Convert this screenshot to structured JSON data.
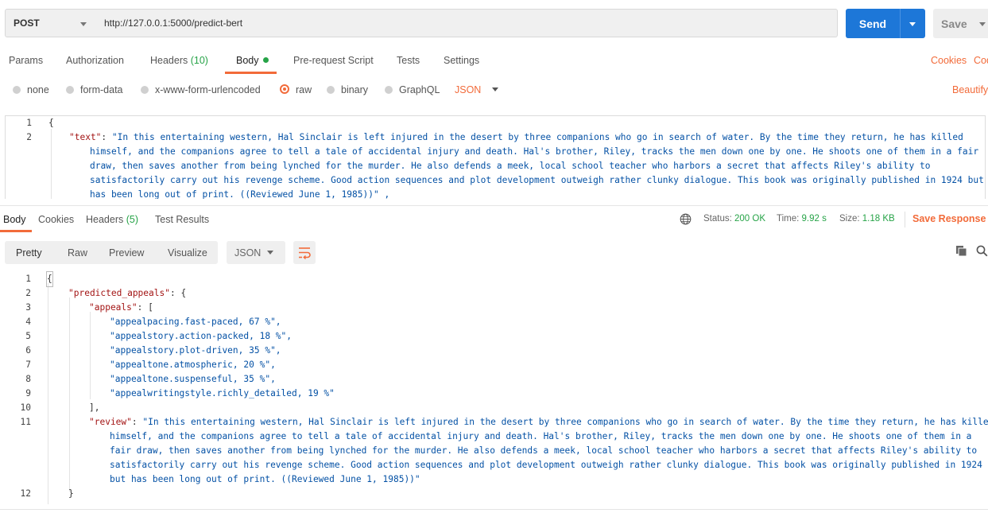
{
  "request": {
    "method": "POST",
    "url": "http://127.0.0.1:5000/predict-bert",
    "send_label": "Send",
    "save_label": "Save"
  },
  "request_tabs": {
    "params": "Params",
    "authorization": "Authorization",
    "headers": "Headers",
    "headers_count": "(10)",
    "body": "Body",
    "prerequest": "Pre-request Script",
    "tests": "Tests",
    "settings": "Settings",
    "cookies": "Cookies",
    "code": "Cod"
  },
  "body_types": {
    "none": "none",
    "form_data": "form-data",
    "urlencoded": "x-www-form-urlencoded",
    "raw": "raw",
    "binary": "binary",
    "graphql": "GraphQL",
    "format": "JSON",
    "beautify": "Beautify"
  },
  "request_body": {
    "line_numbers": [
      "1",
      "2"
    ],
    "open_brace": "{",
    "key": "\"text\"",
    "colon": ": ",
    "value_lines": [
      "\"In this entertaining western, Hal Sinclair is left injured in the desert by three companions who go in search of water. By the time they return, he has killed",
      "himself, and the companions agree to tell a tale of accidental injury and death. Hal's brother, Riley, tracks the men down one by one. He shoots one of them in a fair",
      "draw, then saves another from being lynched for the murder. He also defends a meek, local school teacher who harbors a secret that affects Riley's ability to",
      "satisfactorily carry out his revenge scheme. Good action sequences and plot development outweigh rather clunky dialogue. This book was originally published in 1924 but",
      "has been long out of print. ((Reviewed June 1, 1985))\" ,"
    ]
  },
  "response_tabs": {
    "body": "Body",
    "cookies": "Cookies",
    "headers": "Headers",
    "headers_count": "(5)",
    "test_results": "Test Results"
  },
  "response_status": {
    "status_label": "Status:",
    "status_value": "200 OK",
    "time_label": "Time:",
    "time_value": "9.92 s",
    "size_label": "Size:",
    "size_value": "1.18 KB",
    "save_response": "Save Response"
  },
  "view_modes": {
    "pretty": "Pretty",
    "raw": "Raw",
    "preview": "Preview",
    "visualize": "Visualize",
    "format": "JSON"
  },
  "response_body": {
    "line_numbers": [
      "1",
      "2",
      "3",
      "4",
      "5",
      "6",
      "7",
      "8",
      "9",
      "10",
      "11",
      "12"
    ],
    "open_brace": "{",
    "predicted_key": "\"predicted_appeals\"",
    "predicted_open": ": {",
    "appeals_key": "\"appeals\"",
    "appeals_open": ": [",
    "appeals": [
      "\"appealpacing.fast-paced, 67 %\",",
      "\"appealstory.action-packed, 18 %\",",
      "\"appealstory.plot-driven, 35 %\",",
      "\"appealtone.atmospheric, 20 %\",",
      "\"appealtone.suspenseful, 35 %\",",
      "\"appealwritingstyle.richly_detailed, 19 %\""
    ],
    "appeals_close": "],",
    "review_key": "\"review\"",
    "review_colon": ": ",
    "review_lines": [
      "\"In this entertaining western, Hal Sinclair is left injured in the desert by three companions who go in search of water. By the time they return, he has killed",
      "himself, and the companions agree to tell a tale of accidental injury and death. Hal's brother, Riley, tracks the men down one by one. He shoots one of them in a",
      "fair draw, then saves another from being lynched for the murder. He also defends a meek, local school teacher who harbors a secret that affects Riley's ability to",
      "satisfactorily carry out his revenge scheme. Good action sequences and plot development outweigh rather clunky dialogue. This book was originally published in 1924",
      "but has been long out of print. ((Reviewed June 1, 1985))\""
    ],
    "close_inner": "}"
  },
  "icons": {
    "send_dropdown": "chevron-down-icon",
    "globe": "globe-icon",
    "wrap": "wrap-lines-icon",
    "copy": "copy-icon",
    "search": "search-icon"
  },
  "colors": {
    "accent": "#f26b3a",
    "send": "#1d77d8",
    "success": "#26a347",
    "json_key": "#a31515",
    "json_string": "#0451a5"
  }
}
